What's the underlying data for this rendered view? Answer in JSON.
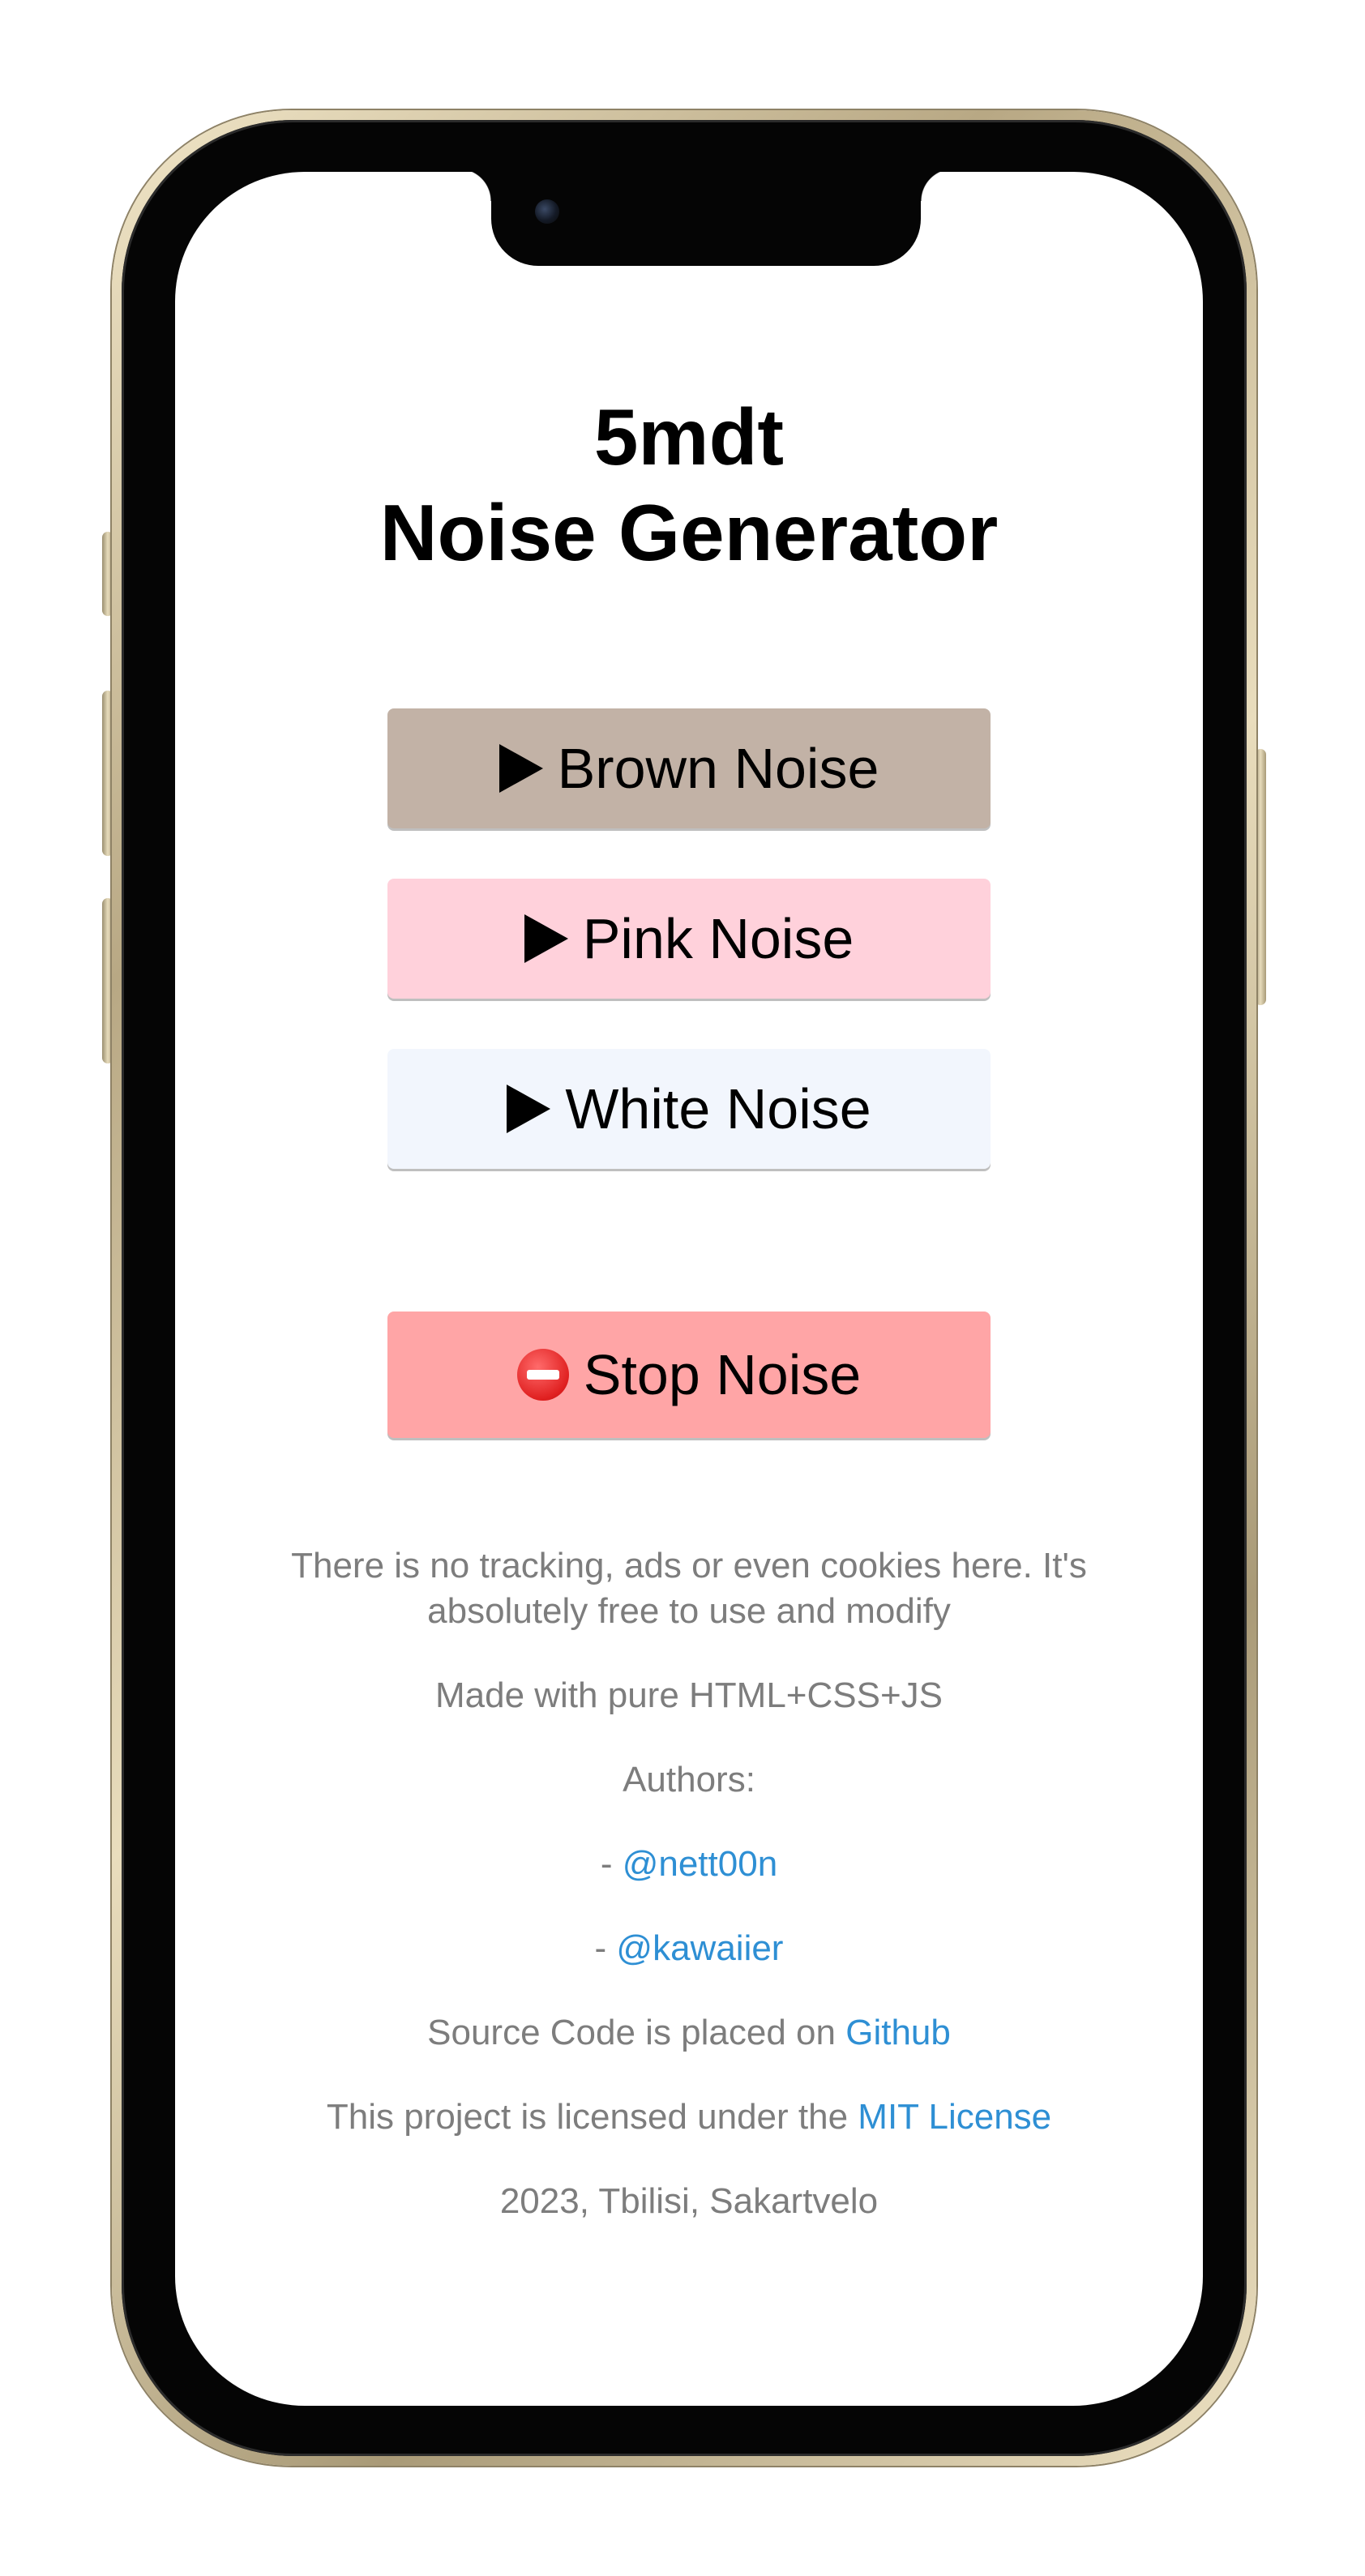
{
  "app": {
    "title_line1": "5mdt",
    "title_line2": "Noise Generator"
  },
  "buttons": {
    "brown": {
      "label": "Brown Noise",
      "icon": "play-icon",
      "color": "#c2b2a6"
    },
    "pink": {
      "label": "Pink Noise",
      "icon": "play-icon",
      "color": "#ffd1db"
    },
    "white": {
      "label": "White Noise",
      "icon": "play-icon",
      "color": "#f2f6fd"
    },
    "stop": {
      "label": "Stop Noise",
      "icon": "no-entry-icon",
      "color": "#ffa5a6"
    }
  },
  "footer": {
    "privacy": "There is no tracking, ads or even cookies here. It's absolutely free to use and modify",
    "made_with": "Made with pure HTML+CSS+JS",
    "authors_label": "Authors:",
    "author_prefix": "- ",
    "authors": [
      "@nett00n",
      "@kawaiier"
    ],
    "source_prefix": "Source Code is placed on ",
    "source_link": "Github",
    "license_prefix": "This project is licensed under the ",
    "license_link": "MIT License",
    "location": "2023, Tbilisi, Sakartvelo"
  },
  "colors": {
    "link": "#2e8fd4",
    "muted_text": "#7d7d7d"
  }
}
